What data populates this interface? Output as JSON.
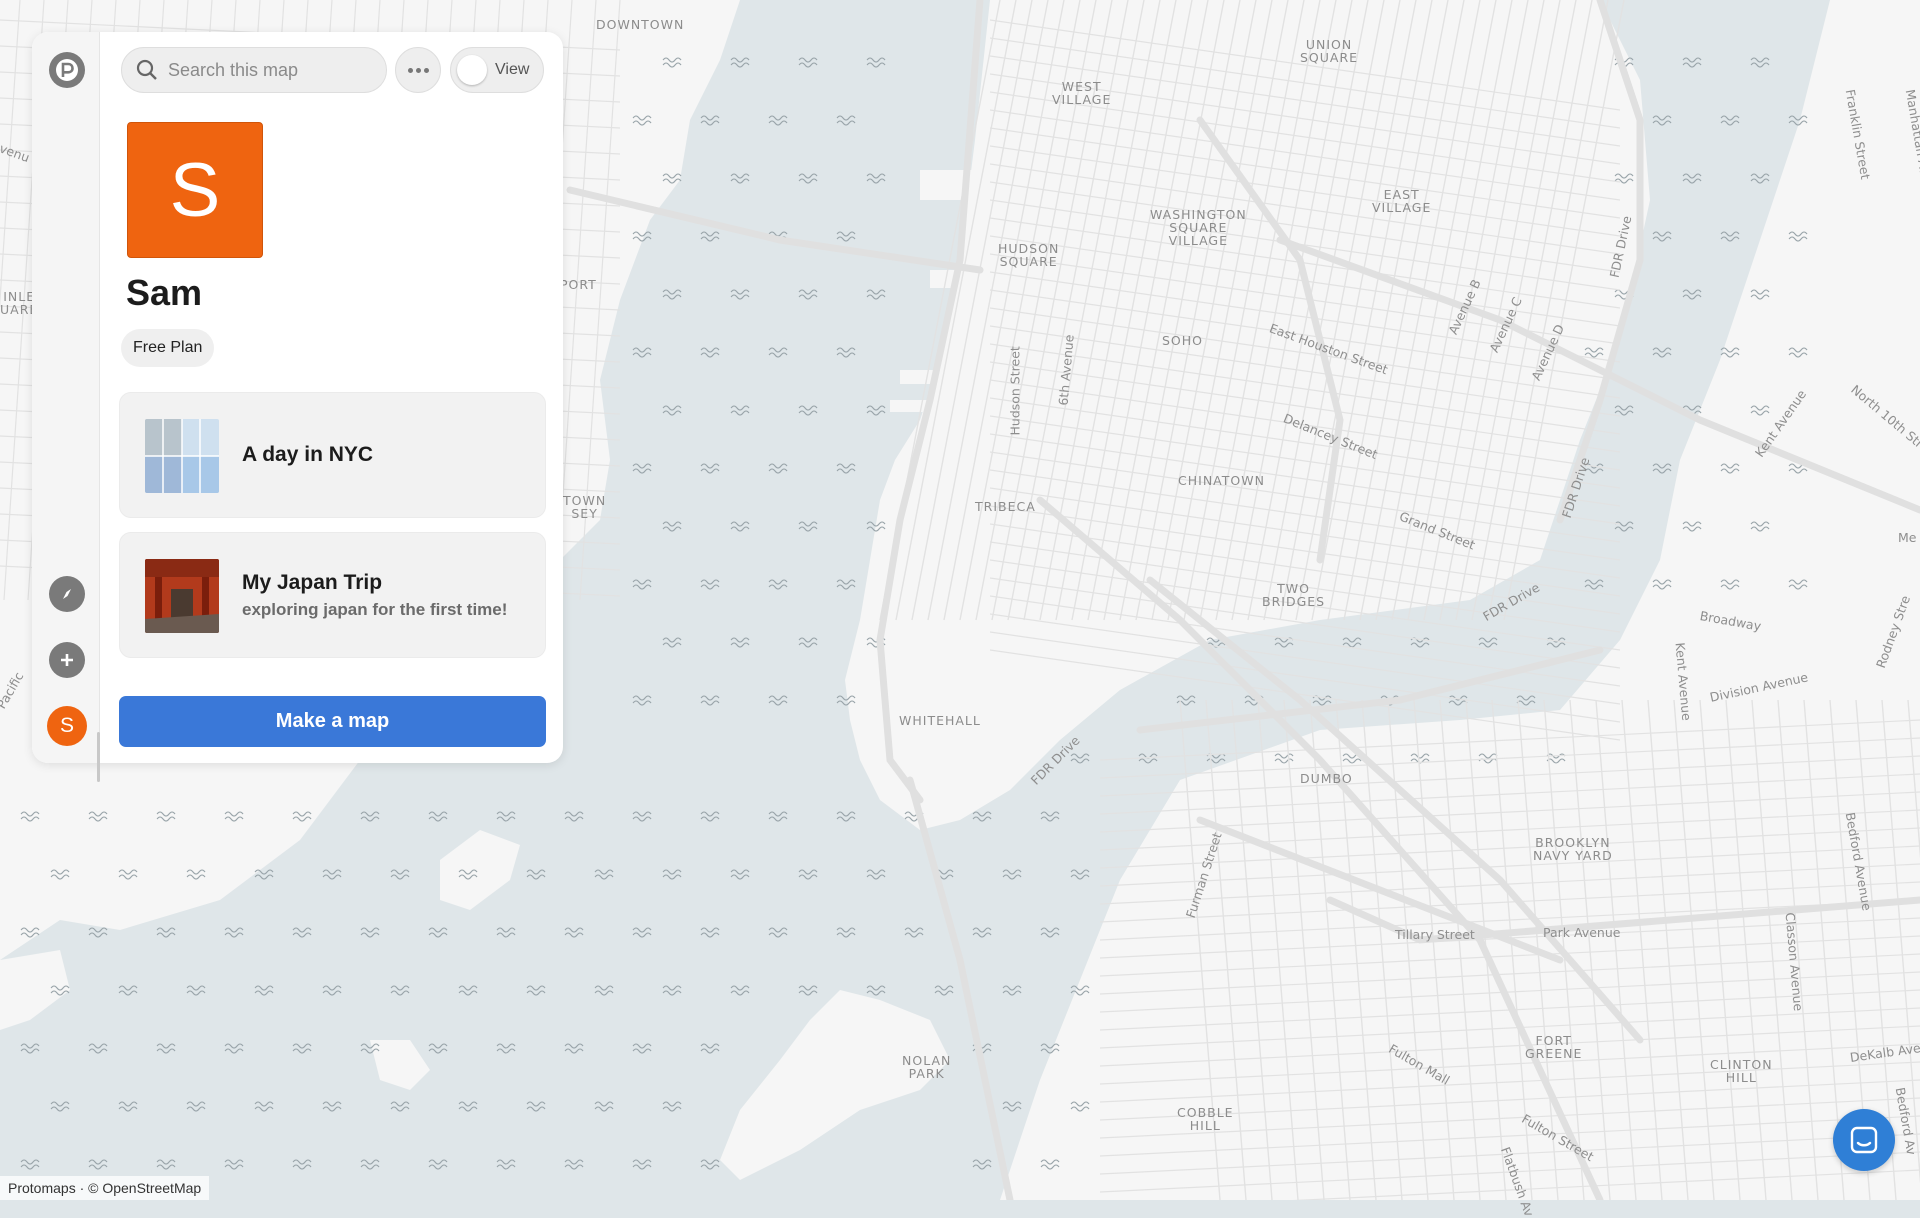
{
  "search": {
    "placeholder": "Search this map"
  },
  "view_toggle": {
    "label": "View"
  },
  "profile": {
    "initial": "S",
    "name": "Sam",
    "plan": "Free Plan"
  },
  "maps": [
    {
      "title": "A day in NYC",
      "description": ""
    },
    {
      "title": "My Japan Trip",
      "description": "exploring japan for the first time!"
    }
  ],
  "actions": {
    "make_map": "Make a map"
  },
  "rail": {
    "avatar_initial": "S"
  },
  "attribution": "Protomaps · © OpenStreetMap",
  "map_labels": {
    "downtown": "DOWNTOWN",
    "union_square": "UNION\nSQUARE",
    "west_village": "WEST\nVILLAGE",
    "east_village": "EAST\nVILLAGE",
    "washington_square": "WASHINGTON\nSQUARE\nVILLAGE",
    "hudson_square": "HUDSON\nSQUARE",
    "soho": "SOHO",
    "chinatown": "CHINATOWN",
    "tribeca": "TRIBECA",
    "two_bridges": "TWO\nBRIDGES",
    "whitehall": "WHITEHALL",
    "dumbo": "DUMBO",
    "brooklyn_navy_yard": "BROOKLYN\nNAVY YARD",
    "fort_greene": "FORT\nGREENE",
    "clinton_hill": "CLINTON\nHILL",
    "cobble_hill": "COBBLE\nHILL",
    "nolan_park": "NOLAN\nPARK",
    "port": "PORT",
    "town": "TOWN\nSEY",
    "inle": "INLE\nUARE"
  },
  "street_labels": {
    "east_houston": "East Houston Street",
    "delancey": "Delancey Street",
    "grand": "Grand Street",
    "fdr1": "FDR Drive",
    "fdr2": "FDR Drive",
    "fdr3": "FDR Drive",
    "fdr4": "FDR Drive",
    "hudson": "Hudson Street",
    "sixth_ave": "6th Avenue",
    "avenue_b": "Avenue B",
    "avenue_c": "Avenue C",
    "avenue_d": "Avenue D",
    "franklin": "Franklin Street",
    "manhattan_ave": "Manhattan Ave",
    "kent": "Kent Avenue",
    "north_10th": "North 10th Stre",
    "broadway": "Broadway",
    "division": "Division Avenue",
    "kent_ave2": "Kent Avenue",
    "rodney": "Rodney Stre",
    "bedford": "Bedford Avenue",
    "classon": "Classon Avenue",
    "park": "Park Avenue",
    "tillary": "Tillary Street",
    "furman": "Furman Street",
    "fulton_mall": "Fulton Mall",
    "fulton": "Fulton Street",
    "flatbush": "Flatbush Av",
    "dekalb": "DeKalb Ave",
    "bedford2": "Bedford Av",
    "pacific": "Pacific",
    "venu": "venu",
    "me": "Me"
  },
  "colors": {
    "water": "#dfe6e9",
    "land": "#f6f6f6",
    "road": "#e3e3e3",
    "accent_orange": "#ef6410",
    "accent_blue": "#3a78d8"
  },
  "icons": {
    "logo": "protomaps-logo-icon",
    "search": "search-icon",
    "more": "more-horizontal-icon",
    "compass": "compass-icon",
    "add": "plus-icon",
    "chat": "chat-icon"
  }
}
